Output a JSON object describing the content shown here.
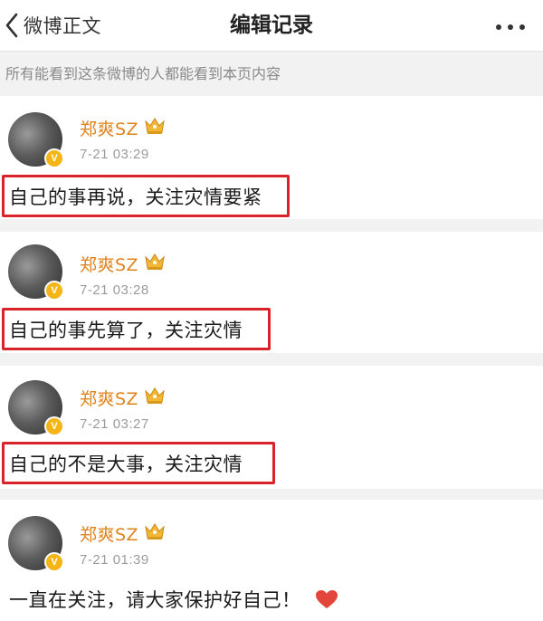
{
  "navbar": {
    "back_label": "微博正文",
    "title": "编辑记录"
  },
  "notice": "所有能看到这条微博的人都能看到本页内容",
  "records": [
    {
      "username": "郑爽SZ",
      "timestamp": "7-21 03:29",
      "content": "自己的事再说，关注灾情要紧",
      "highlighted": true
    },
    {
      "username": "郑爽SZ",
      "timestamp": "7-21 03:28",
      "content": "自己的事先算了，关注灾情",
      "highlighted": true
    },
    {
      "username": "郑爽SZ",
      "timestamp": "7-21 03:27",
      "content": "自己的不是大事，关注灾情",
      "highlighted": true
    },
    {
      "username": "郑爽SZ",
      "timestamp": "7-21 01:39",
      "content": "一直在关注，请大家保护好自己！",
      "highlighted": false,
      "trailing_icon": "heart-icon"
    }
  ],
  "colors": {
    "username": "#e0831d",
    "highlight_border": "#d8232a",
    "verified_badge": "#f6b516",
    "heart": "#e2463a"
  },
  "icons": {
    "back": "chevron-left-icon",
    "more": "more-dots-icon",
    "verified": "verified-badge-icon",
    "membership": "crown-icon"
  }
}
